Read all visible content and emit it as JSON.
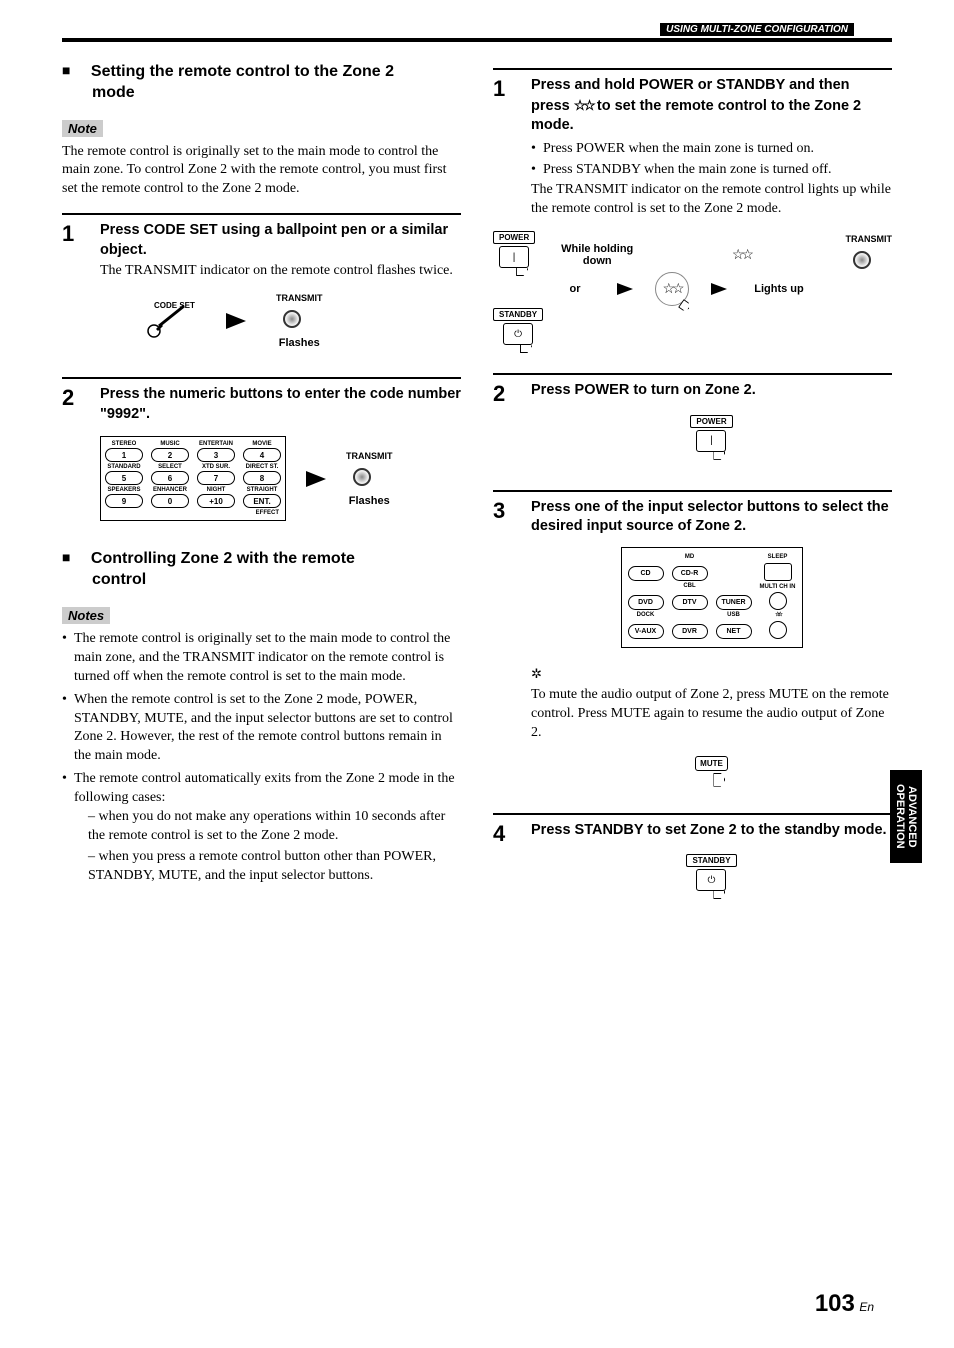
{
  "header": {
    "section_tag": "USING MULTI-ZONE CONFIGURATION"
  },
  "left": {
    "h1a": "Setting the remote control to the Zone 2",
    "h1b": "mode",
    "note_label": "Note",
    "note_body": "The remote control is originally set to the main mode to control the main zone. To control Zone 2 with the remote control, you must first set the remote control to the Zone 2 mode.",
    "step1_num": "1",
    "step1_head": "Press CODE SET using a ballpoint pen or a similar object.",
    "step1_text": "The TRANSMIT indicator on the remote control flashes twice.",
    "codeset_label": "CODE SET",
    "transmit_label": "TRANSMIT",
    "flashes_label": "Flashes",
    "step2_num": "2",
    "step2_head": "Press the numeric buttons to enter the code number \"9992\".",
    "keypad": {
      "r1": [
        "STEREO",
        "MUSIC",
        "ENTERTAIN",
        "MOVIE"
      ],
      "b1": [
        "1",
        "2",
        "3",
        "4"
      ],
      "r2": [
        "STANDARD",
        "SELECT",
        "XTD SUR.",
        "DIRECT ST."
      ],
      "b2": [
        "5",
        "6",
        "7",
        "8"
      ],
      "r3": [
        "SPEAKERS",
        "ENHANCER",
        "NIGHT",
        "STRAIGHT"
      ],
      "b3": [
        "9",
        "0",
        "+10",
        "ENT."
      ],
      "effect": "EFFECT"
    },
    "h2a": "Controlling Zone 2 with the remote",
    "h2b": "control",
    "notes_label": "Notes",
    "notes": {
      "n1": "The remote control is originally set to the main mode to control the main zone, and the TRANSMIT indicator on the remote control is turned off when the remote control is set to the main mode.",
      "n2": "When the remote control is set to the Zone 2 mode, POWER, STANDBY, MUTE, and the input selector buttons are set to control Zone 2. However, the rest of the remote control buttons remain in the main mode.",
      "n3": "The remote control automatically exits from the Zone 2 mode in the following cases:",
      "n3a": "when you do not make any operations within 10 seconds after the remote control is set to the Zone 2 mode.",
      "n3b": "when you press a remote control button other than POWER, STANDBY, MUTE, and the input selector buttons."
    }
  },
  "right": {
    "step1_num": "1",
    "step1_head_a": "Press and hold POWER or STANDBY and then press ",
    "step1_head_star": "☆☆",
    "step1_head_b": " to set the remote control to the Zone 2 mode.",
    "step1_b1": "Press POWER when the main zone is turned on.",
    "step1_b2": "Press STANDBY when the main zone is turned off.",
    "step1_text": "The TRANSMIT indicator on the remote control lights up while the remote control is set to the Zone 2 mode.",
    "power_label": "POWER",
    "standby_label": "STANDBY",
    "holding_a": "While holding",
    "holding_b": "down",
    "or_label": "or",
    "star_label": "☆☆",
    "transmit_label": "TRANSMIT",
    "lights_label": "Lights up",
    "step2_num": "2",
    "step2_head": "Press POWER to turn on Zone 2.",
    "step3_num": "3",
    "step3_head": "Press one of the input selector buttons to select the desired input source of Zone 2.",
    "selectors": {
      "md": "MD",
      "sleep": "SLEEP",
      "cd": "CD",
      "cdr": "CD-R",
      "cbl": "CBL",
      "multich": "MULTI CH IN",
      "dvd": "DVD",
      "dtv": "DTV",
      "tuner": "TUNER",
      "dock": "DOCK",
      "usb": "USB",
      "star": "☆☆",
      "vaux": "V-AUX",
      "dvr": "DVR",
      "net": "NET"
    },
    "tip_icon": "✲",
    "tip_text": "To mute the audio output of Zone 2, press MUTE on the remote control. Press MUTE again to resume the audio output of Zone 2.",
    "mute_label": "MUTE",
    "step4_num": "4",
    "step4_head": "Press STANDBY to set Zone 2 to the standby mode."
  },
  "side_tab_a": "ADVANCED",
  "side_tab_b": "OPERATION",
  "pagenum": "103",
  "pagesuffix": "En"
}
